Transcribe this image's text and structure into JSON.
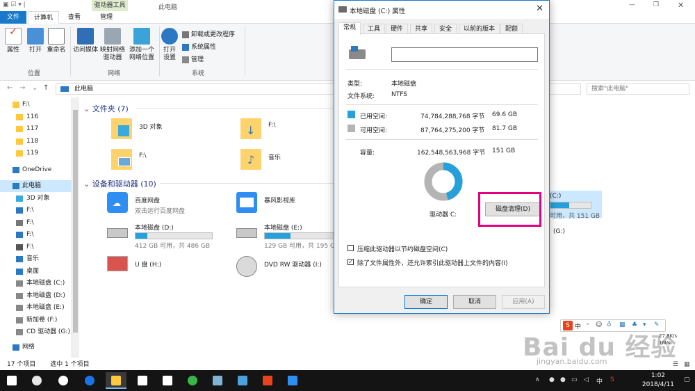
{
  "explorer": {
    "tabs": [
      "文件",
      "计算机",
      "查看",
      "管理"
    ],
    "context_group": "驱动器工具",
    "window_title": "此电脑",
    "ribbon": {
      "location": {
        "group": "位置",
        "buttons": [
          "属性",
          "打开",
          "重命名"
        ]
      },
      "network": {
        "group": "网络",
        "buttons": [
          "访问媒体",
          "映射网络驱动器",
          "添加一个网络位置"
        ]
      },
      "system": {
        "group": "系统",
        "open_settings": "打开设置",
        "small": [
          "卸载或更改程序",
          "系统属性",
          "管理"
        ]
      }
    },
    "address": "此电脑",
    "search_placeholder": "搜索\"此电脑\"",
    "nav": [
      {
        "label": "F:\\",
        "top": true
      },
      {
        "label": "116"
      },
      {
        "label": "117"
      },
      {
        "label": "118"
      },
      {
        "label": "119"
      },
      {
        "label": "OneDrive",
        "top": true
      },
      {
        "label": "此电脑",
        "top": true,
        "selected": true
      },
      {
        "label": "3D 对象"
      },
      {
        "label": "F:\\"
      },
      {
        "label": "F:\\"
      },
      {
        "label": "F:\\"
      },
      {
        "label": "F:\\"
      },
      {
        "label": "音乐"
      },
      {
        "label": "桌面"
      },
      {
        "label": "本地磁盘 (C:)"
      },
      {
        "label": "本地磁盘 (D:)"
      },
      {
        "label": "本地磁盘 (E:)"
      },
      {
        "label": "新加卷 (F:)"
      },
      {
        "label": "CD 驱动器 (G:)"
      },
      {
        "label": "网络",
        "top": true
      }
    ],
    "folders_header": "文件夹 (7)",
    "folders": [
      "3D 对象",
      "F:\\",
      "F:\\",
      "音乐"
    ],
    "devices_header": "设备和驱动器 (10)",
    "devices": [
      {
        "name": "百度网盘",
        "sub": "双击运行百度网盘"
      },
      {
        "name": "暴风影视库",
        "sub": ""
      },
      {
        "name": "本地磁盘 (D:)",
        "sub": "412 GB 可用，共 486 GB",
        "used": 0.15
      },
      {
        "name": "本地磁盘 (E:)",
        "sub": "129 GB 可用，共 195 GB",
        "used": 0.34
      },
      {
        "name": "U 盘 (H:)",
        "sub": ""
      },
      {
        "name": "DVD RW 驱动器 (I:)",
        "sub": ""
      }
    ],
    "partial_c": {
      "name": "(C:)",
      "sub": "可用，共 151 GB",
      "used": 0.46
    },
    "partial_g": "(G:)",
    "status_items": "17 个项目",
    "status_selected": "选中 1 个项目"
  },
  "dialog": {
    "title": "本地磁盘 (C:) 属性",
    "tabs": [
      "常规",
      "工具",
      "硬件",
      "共享",
      "安全",
      "以前的版本",
      "配额"
    ],
    "type_label": "类型:",
    "type_value": "本地磁盘",
    "fs_label": "文件系统:",
    "fs_value": "NTFS",
    "used_label": "已用空间:",
    "used_bytes": "74,784,288,768 字节",
    "used_gb": "69.6 GB",
    "free_label": "可用空间:",
    "free_bytes": "87,764,275,200 字节",
    "free_gb": "81.7 GB",
    "cap_label": "容量:",
    "cap_bytes": "162,548,563,968 字节",
    "cap_gb": "151 GB",
    "used_fraction": 0.46,
    "drive_label": "驱动器 C:",
    "clean_button": "磁盘清理(D)",
    "compress_label": "压缩此驱动器以节约磁盘空间(C)",
    "index_label": "除了文件属性外，还允许索引此驱动器上文件的内容(I)",
    "ok": "确定",
    "cancel": "取消",
    "apply": "应用(A)",
    "used_color": "#26a0da",
    "free_color": "#b4b4b4"
  },
  "taskbar": {
    "time": "1:02",
    "date": "2018/4/11",
    "ime": "中"
  },
  "netspeed": {
    "up": "27.8K/s",
    "down": "1M/s"
  }
}
